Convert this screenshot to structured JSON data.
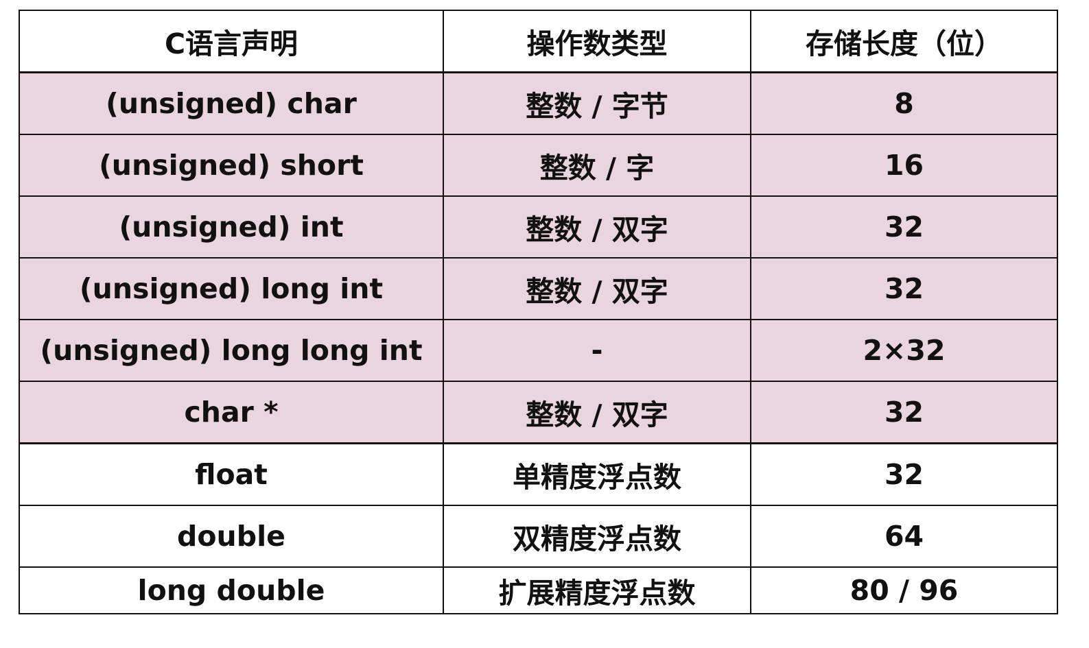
{
  "table": {
    "headers": [
      "C语言声明",
      "操作数类型",
      "存储长度（位）"
    ],
    "rows": [
      {
        "decl": "(unsigned) char",
        "type": "整数 / 字节",
        "bits": "8",
        "group": "integer"
      },
      {
        "decl": "(unsigned) short",
        "type": "整数 / 字",
        "bits": "16",
        "group": "integer"
      },
      {
        "decl": "(unsigned) int",
        "type": "整数 / 双字",
        "bits": "32",
        "group": "integer"
      },
      {
        "decl": "(unsigned) long int",
        "type": "整数 / 双字",
        "bits": "32",
        "group": "integer"
      },
      {
        "decl": "(unsigned) long long int",
        "type": "-",
        "bits": "2×32",
        "group": "integer"
      },
      {
        "decl": "char *",
        "type": "整数 / 双字",
        "bits": "32",
        "group": "integer"
      },
      {
        "decl": "float",
        "type": "单精度浮点数",
        "bits": "32",
        "group": "float"
      },
      {
        "decl": "double",
        "type": "双精度浮点数",
        "bits": "64",
        "group": "float"
      },
      {
        "decl": "long double",
        "type": "扩展精度浮点数",
        "bits": "80 / 96",
        "group": "float"
      }
    ]
  },
  "colors": {
    "integer_row_bg": "#ead5de",
    "float_row_bg": "#ffffff",
    "border": "#111111"
  }
}
